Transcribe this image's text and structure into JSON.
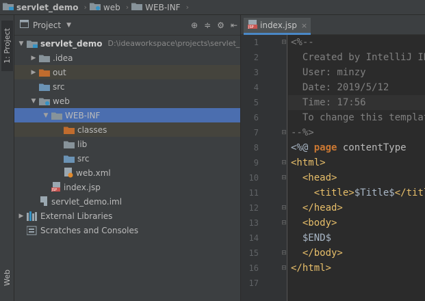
{
  "breadcrumbs": [
    {
      "label": "servlet_demo",
      "bold": true,
      "icon": "module-folder-icon"
    },
    {
      "label": "web",
      "bold": false,
      "icon": "web-folder-icon"
    },
    {
      "label": "WEB-INF",
      "bold": false,
      "icon": "folder-icon"
    }
  ],
  "left_strip": {
    "project_tab": "1: Project",
    "web_tab": "Web"
  },
  "project_panel": {
    "title": "Project",
    "tools": [
      "globe-icon",
      "collapse-icon",
      "gear-icon",
      "hide-icon"
    ]
  },
  "tree": [
    {
      "label": "servlet_demo",
      "path": "D:\\ideaworkspace\\projects\\servlet_",
      "depth": 0,
      "expanded": true,
      "icon": "module",
      "bold": true
    },
    {
      "label": ".idea",
      "depth": 1,
      "expanded": false,
      "icon": "folder"
    },
    {
      "label": "out",
      "depth": 1,
      "expanded": false,
      "icon": "folder-orange",
      "highlight": true
    },
    {
      "label": "src",
      "depth": 1,
      "icon": "folder-blue"
    },
    {
      "label": "web",
      "depth": 1,
      "expanded": true,
      "icon": "folder-web"
    },
    {
      "label": "WEB-INF",
      "depth": 2,
      "expanded": true,
      "icon": "folder",
      "selected": true
    },
    {
      "label": "classes",
      "depth": 3,
      "icon": "folder-orange",
      "highlight": true
    },
    {
      "label": "lib",
      "depth": 3,
      "icon": "folder"
    },
    {
      "label": "src",
      "depth": 3,
      "icon": "folder-blue"
    },
    {
      "label": "web.xml",
      "depth": 3,
      "icon": "xml-file"
    },
    {
      "label": "index.jsp",
      "depth": 2,
      "icon": "jsp-file"
    },
    {
      "label": "servlet_demo.iml",
      "depth": 1,
      "icon": "iml-file"
    },
    {
      "label": "External Libraries",
      "depth": 0,
      "expanded": false,
      "icon": "libraries"
    },
    {
      "label": "Scratches and Consoles",
      "depth": 0,
      "icon": "scratches"
    }
  ],
  "editor": {
    "tab_label": "index.jsp",
    "tab_close": "×",
    "line_numbers": [
      "1",
      "2",
      "3",
      "4",
      "5",
      "6",
      "7",
      "8",
      "9",
      "10",
      "11",
      "12",
      "13",
      "14",
      "15",
      "16",
      "17"
    ],
    "lines": [
      [
        {
          "t": "<%--",
          "c": "cmt"
        }
      ],
      [
        {
          "t": "  Created by IntelliJ IDEA.",
          "c": "cmt"
        }
      ],
      [
        {
          "t": "  User: minzy",
          "c": "cmt"
        }
      ],
      [
        {
          "t": "  Date: 2019/5/12",
          "c": "cmt"
        }
      ],
      [
        {
          "t": "  Time: 17:56",
          "c": "cmt"
        }
      ],
      [
        {
          "t": "  To change this template use File | Settings | File Templates.",
          "c": "cmt"
        }
      ],
      [
        {
          "t": "--%>",
          "c": "cmt"
        }
      ],
      [
        {
          "t": "<%@ ",
          "c": "txt"
        },
        {
          "t": "page ",
          "c": "kw"
        },
        {
          "t": "contentType",
          "c": "attr"
        }
      ],
      [
        {
          "t": "<html>",
          "c": "tagc"
        }
      ],
      [
        {
          "t": "  ",
          "c": "txt"
        },
        {
          "t": "<head>",
          "c": "tagc"
        }
      ],
      [
        {
          "t": "    ",
          "c": "txt"
        },
        {
          "t": "<title>",
          "c": "tagc"
        },
        {
          "t": "$Title$",
          "c": "txt"
        },
        {
          "t": "</title>",
          "c": "tagc"
        }
      ],
      [
        {
          "t": "  ",
          "c": "txt"
        },
        {
          "t": "</head>",
          "c": "tagc"
        }
      ],
      [
        {
          "t": "  ",
          "c": "txt"
        },
        {
          "t": "<body>",
          "c": "tagc"
        }
      ],
      [
        {
          "t": "  $END$",
          "c": "txt"
        }
      ],
      [
        {
          "t": "  ",
          "c": "txt"
        },
        {
          "t": "</body>",
          "c": "tagc"
        }
      ],
      [
        {
          "t": "</html>",
          "c": "tagc"
        }
      ],
      [
        {
          "t": "",
          "c": "txt"
        }
      ]
    ],
    "current_line": 5
  },
  "colors": {
    "selection": "#4b6eaf",
    "folder": "#87939a",
    "folder_orange": "#c06c2e",
    "folder_blue": "#6b93b5",
    "tag": "#e8bf6a",
    "keyword": "#cc7832",
    "comment": "#808080"
  }
}
